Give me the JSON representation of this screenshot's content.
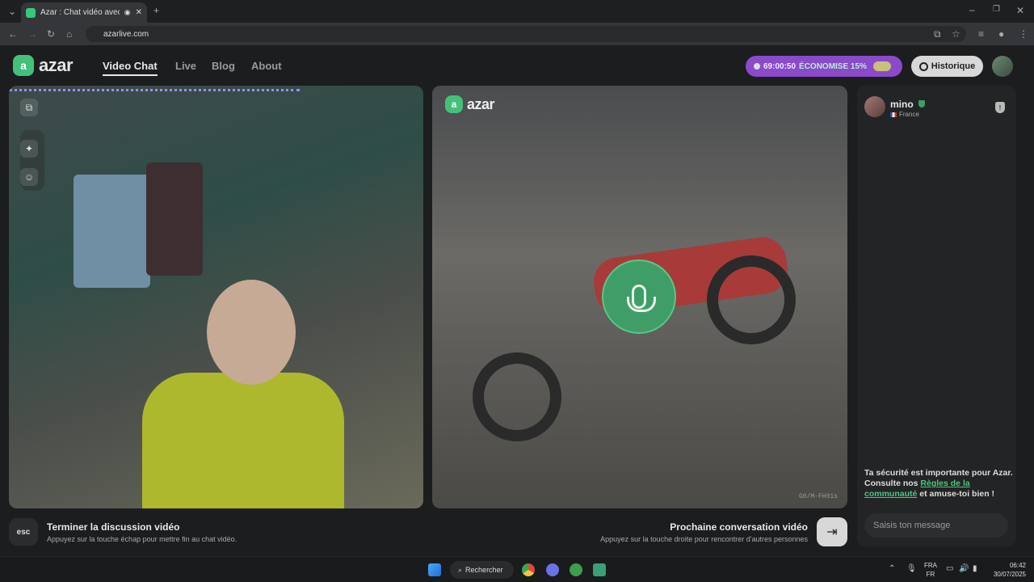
{
  "browser": {
    "tab_title": "Azar : Chat vidéo avec de n",
    "url": "azarlive.com"
  },
  "header": {
    "logo_text": "azar",
    "nav": [
      {
        "label": "Video Chat",
        "active": true
      },
      {
        "label": "Live"
      },
      {
        "label": "Blog"
      },
      {
        "label": "About"
      }
    ],
    "promo_timer": "69:00:50",
    "promo_text": "ÉCONOMISE 15%",
    "history_label": "Historique",
    "promo_color": "#8a4ac9"
  },
  "video": {
    "right_logo": "azar",
    "watermark": "G0/M-FH91s"
  },
  "controls": {
    "esc_label": "esc",
    "end_title": "Terminer la discussion vidéo",
    "end_sub": "Appuyez sur la touche échap pour mettre fin au chat vidéo.",
    "next_title": "Prochaine conversation vidéo",
    "next_sub": "Appuyez sur la touche droite pour rencontrer d'autres personnes",
    "next_icon": "arrow-right-icon"
  },
  "chat": {
    "peer_name": "mino",
    "peer_country": "France",
    "safety_pre": "Ta sécurité est importante pour Azar. Consulte nos ",
    "safety_link": "Règles de la communauté",
    "safety_post": " et amuse-toi bien !",
    "input_placeholder": "Saisis ton message",
    "accent": "#4bc580"
  },
  "taskbar": {
    "search_label": "Rechercher",
    "lang_1": "FRA",
    "lang_2": "FR",
    "time": "06:42",
    "date": "30/07/2025"
  }
}
